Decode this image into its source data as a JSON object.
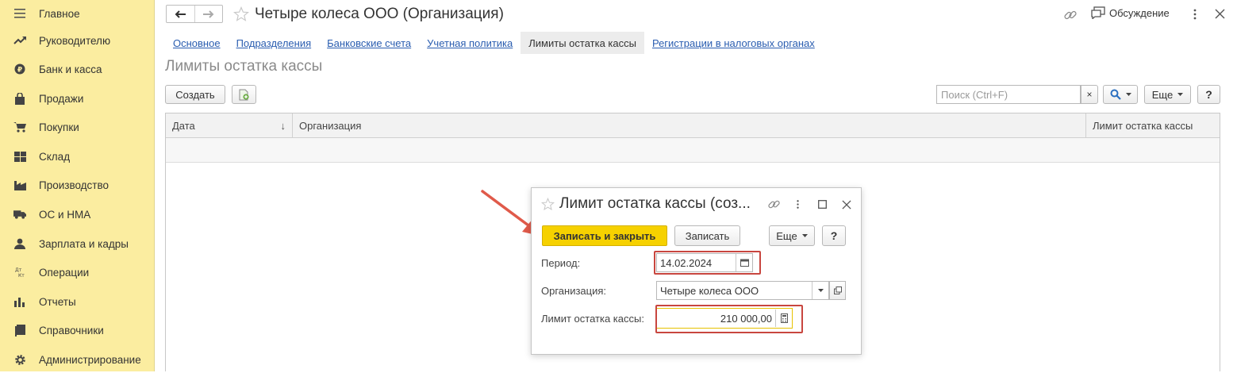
{
  "sidebar": {
    "items": [
      {
        "label": "Главное",
        "icon": "menu-icon"
      },
      {
        "label": "Руководителю",
        "icon": "trend-icon"
      },
      {
        "label": "Банк и касса",
        "icon": "coin-icon"
      },
      {
        "label": "Продажи",
        "icon": "bag-icon"
      },
      {
        "label": "Покупки",
        "icon": "cart-icon"
      },
      {
        "label": "Склад",
        "icon": "warehouse-icon"
      },
      {
        "label": "Производство",
        "icon": "factory-icon"
      },
      {
        "label": "ОС и НМА",
        "icon": "truck-icon"
      },
      {
        "label": "Зарплата и кадры",
        "icon": "person-icon"
      },
      {
        "label": "Операции",
        "icon": "operations-icon"
      },
      {
        "label": "Отчеты",
        "icon": "bar-chart-icon"
      },
      {
        "label": "Справочники",
        "icon": "book-icon"
      },
      {
        "label": "Администрирование",
        "icon": "gear-icon"
      }
    ]
  },
  "header": {
    "title": "Четыре колеса ООО (Организация)",
    "discussion_label": "Обсуждение"
  },
  "tabs": [
    {
      "label": "Основное",
      "active": false
    },
    {
      "label": "Подразделения",
      "active": false
    },
    {
      "label": "Банковские счета",
      "active": false
    },
    {
      "label": "Учетная политика",
      "active": false
    },
    {
      "label": "Лимиты остатка кассы",
      "active": true
    },
    {
      "label": "Регистрации в налоговых органах",
      "active": false
    }
  ],
  "section": {
    "title": "Лимиты остатка кассы"
  },
  "toolbar": {
    "create_label": "Создать",
    "search_placeholder": "Поиск (Ctrl+F)",
    "clear_label": "×",
    "more_label": "Еще",
    "help_label": "?"
  },
  "table": {
    "columns": [
      "Дата",
      "Организация",
      "Лимит остатка кассы"
    ],
    "sort_indicator": "↓",
    "rows": []
  },
  "dialog": {
    "title": "Лимит остатка кассы (соз...",
    "save_close_label": "Записать и закрыть",
    "save_label": "Записать",
    "more_label": "Еще",
    "help_label": "?",
    "period_label": "Период:",
    "period_value": "14.02.2024",
    "org_label": "Организация:",
    "org_value": "Четыре колеса ООО",
    "limit_label": "Лимит остатка кассы:",
    "limit_value": "210 000,00"
  },
  "colors": {
    "sidebar_bg": "#fbeda0",
    "link": "#2a5db0",
    "primary_button": "#f6d100",
    "highlight": "#c8463f"
  }
}
